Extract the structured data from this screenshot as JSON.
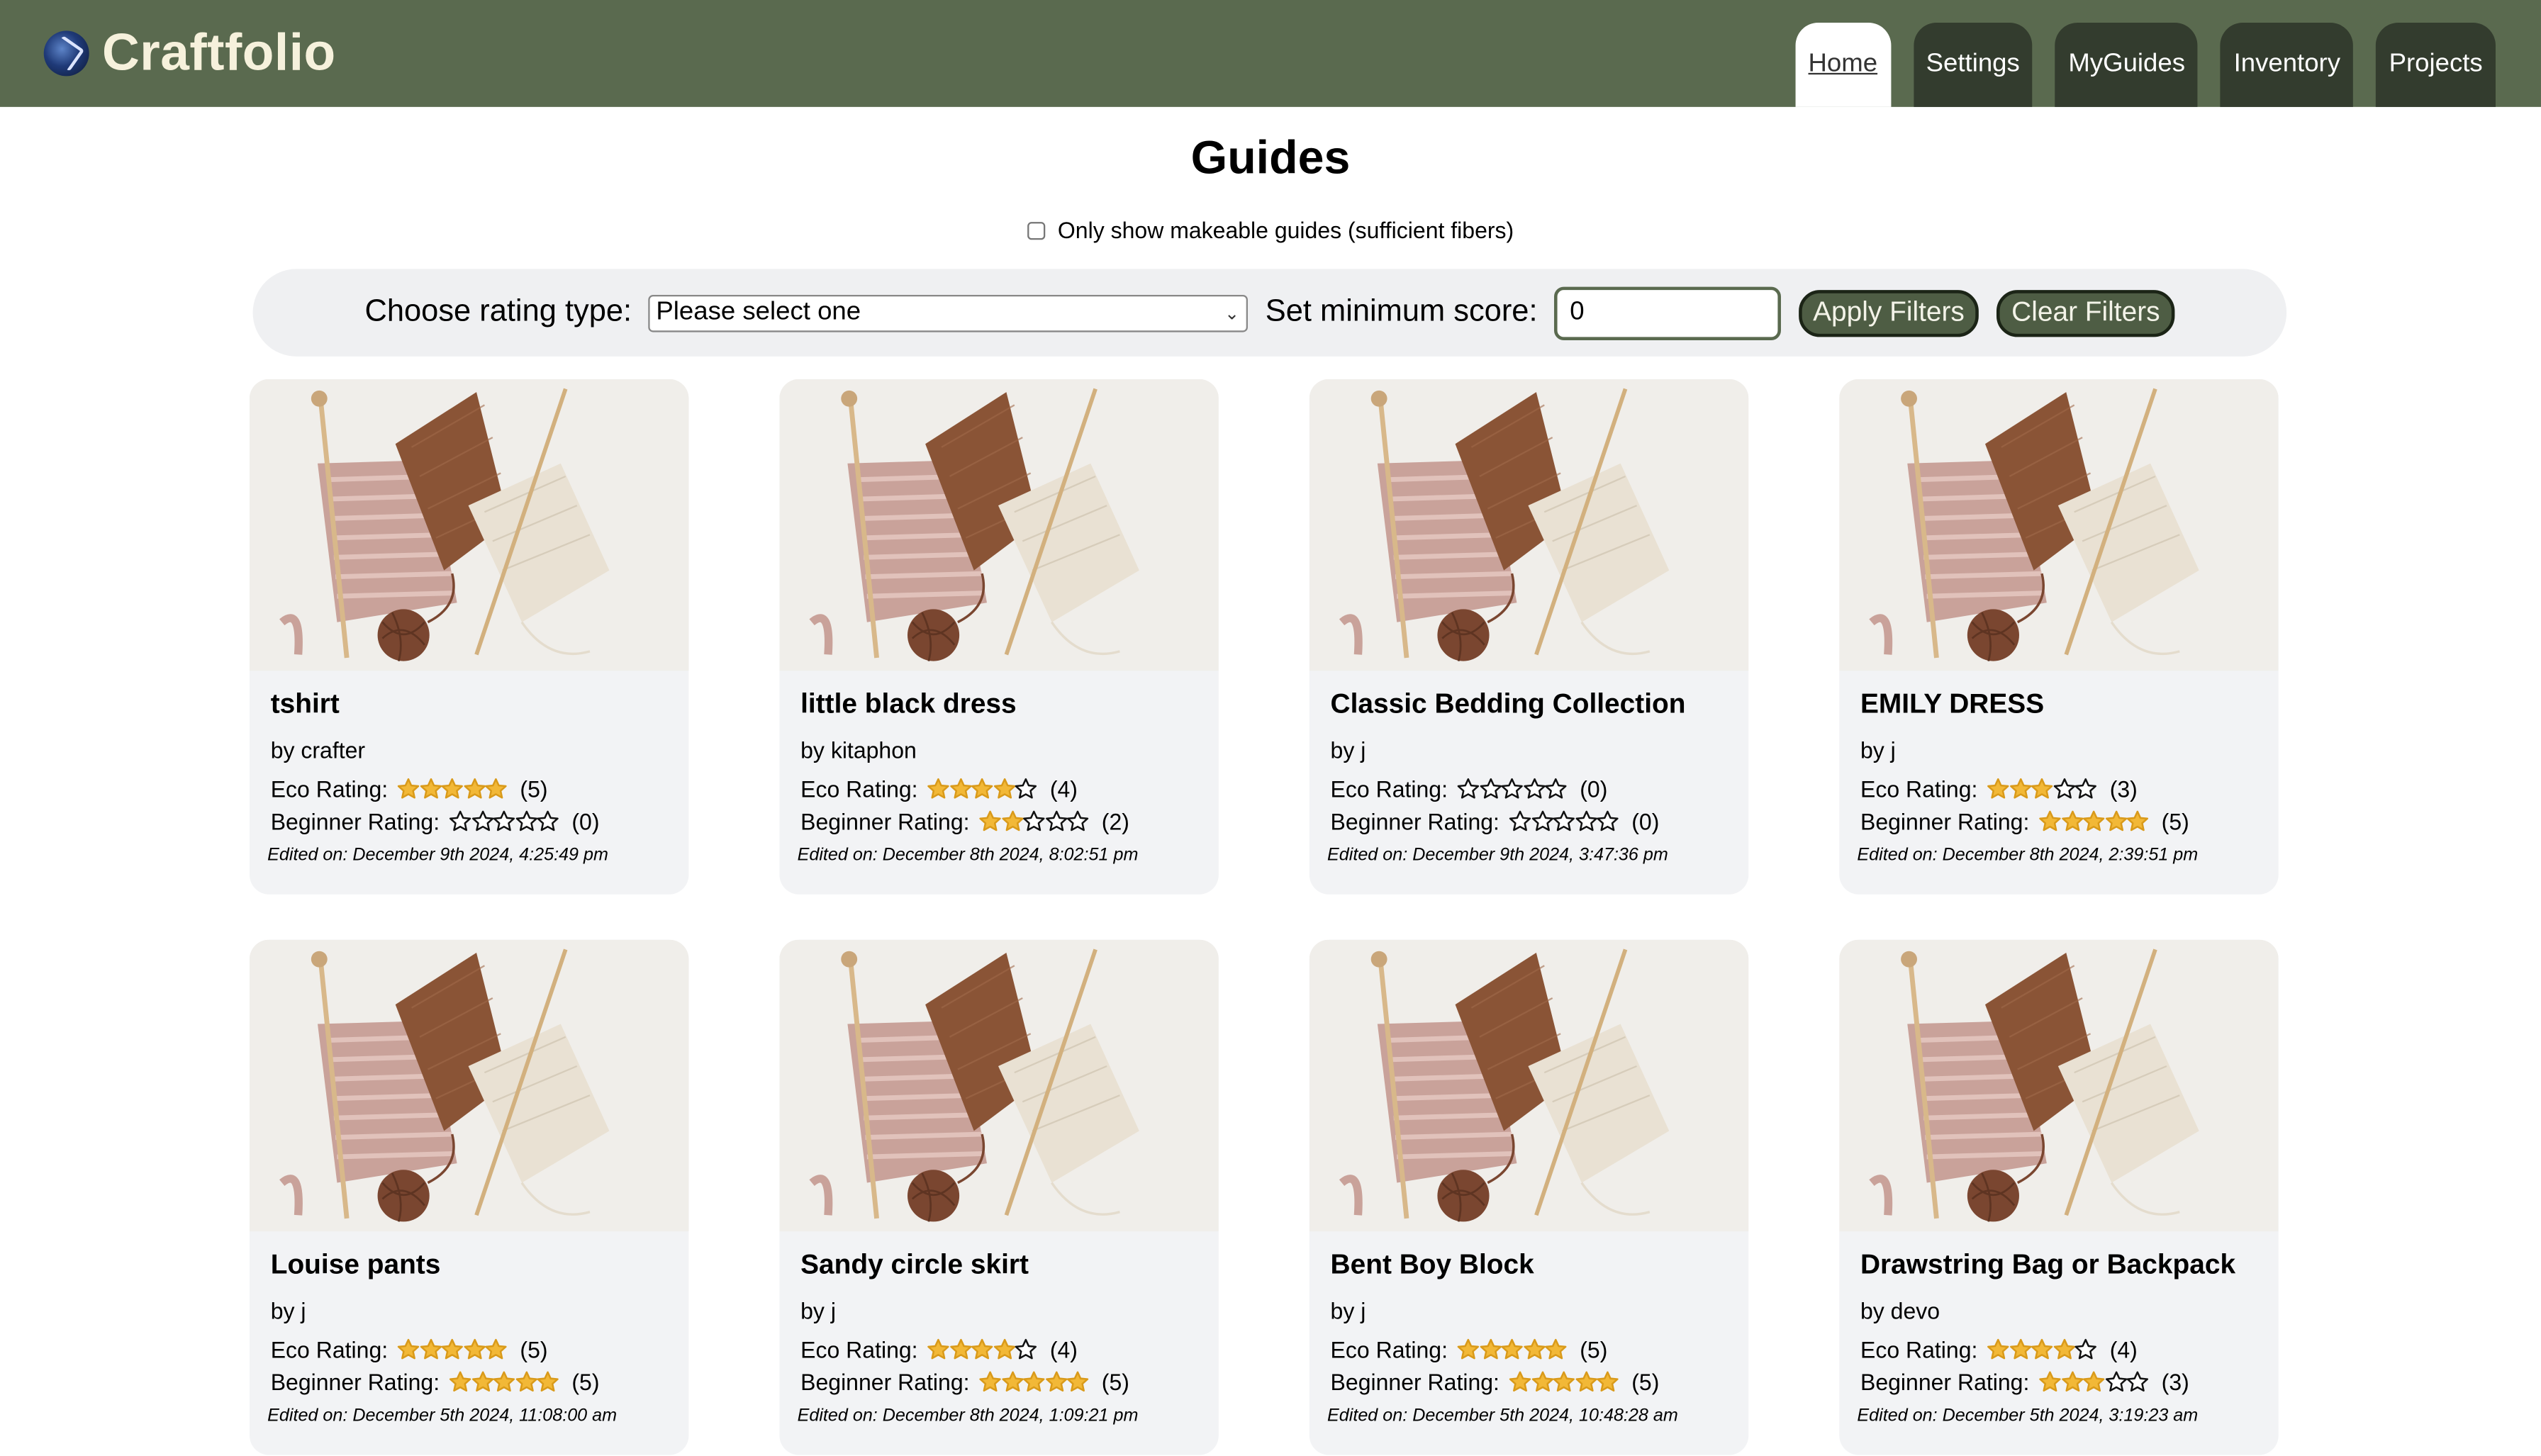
{
  "app": {
    "brand": "Craftfolio",
    "brand_color": "#5a6a4f",
    "logo_icon": "globe-logo-icon"
  },
  "nav": [
    {
      "label": "Home",
      "active": true
    },
    {
      "label": "Settings",
      "active": false
    },
    {
      "label": "MyGuides",
      "active": false
    },
    {
      "label": "Inventory",
      "active": false
    },
    {
      "label": "Projects",
      "active": false
    }
  ],
  "page": {
    "title": "Guides",
    "makeable_label": "Only show makeable guides (sufficient fibers)",
    "makeable_checked": false
  },
  "filters": {
    "rating_type_label": "Choose rating type:",
    "rating_type_value": "Please select one",
    "min_score_label": "Set minimum score:",
    "min_score_value": "0",
    "apply_label": "Apply Filters",
    "clear_label": "Clear Filters"
  },
  "labels": {
    "eco": "Eco Rating:",
    "beginner": "Beginner Rating:"
  },
  "guides": [
    {
      "title": "tshirt",
      "author": "by crafter",
      "eco": 5,
      "eco_count": "(5)",
      "beginner": 0,
      "beginner_count": "(0)",
      "edited": "Edited on: December 9th 2024, 4:25:49 pm"
    },
    {
      "title": "little black dress",
      "author": "by kitaphon",
      "eco": 4,
      "eco_count": "(4)",
      "beginner": 2,
      "beginner_count": "(2)",
      "edited": "Edited on: December 8th 2024, 8:02:51 pm"
    },
    {
      "title": "Classic Bedding Collection",
      "author": "by j",
      "eco": 0,
      "eco_count": "(0)",
      "beginner": 0,
      "beginner_count": "(0)",
      "edited": "Edited on: December 9th 2024, 3:47:36 pm"
    },
    {
      "title": "EMILY DRESS",
      "author": "by j",
      "eco": 3,
      "eco_count": "(3)",
      "beginner": 5,
      "beginner_count": "(5)",
      "edited": "Edited on: December 8th 2024, 2:39:51 pm"
    },
    {
      "title": "Louise pants",
      "author": "by j",
      "eco": 5,
      "eco_count": "(5)",
      "beginner": 5,
      "beginner_count": "(5)",
      "edited": "Edited on: December 5th 2024, 11:08:00 am"
    },
    {
      "title": "Sandy circle skirt",
      "author": "by j",
      "eco": 4,
      "eco_count": "(4)",
      "beginner": 5,
      "beginner_count": "(5)",
      "edited": "Edited on: December 8th 2024, 1:09:21 pm"
    },
    {
      "title": "Bent Boy Block",
      "author": "by j",
      "eco": 5,
      "eco_count": "(5)",
      "beginner": 5,
      "beginner_count": "(5)",
      "edited": "Edited on: December 5th 2024, 10:48:28 am"
    },
    {
      "title": "Drawstring Bag or Backpack",
      "author": "by devo",
      "eco": 4,
      "eco_count": "(4)",
      "beginner": 3,
      "beginner_count": "(3)",
      "edited": "Edited on: December 5th 2024, 3:19:23 am"
    }
  ],
  "colors": {
    "star_fill": "#f2b837",
    "card_bg": "#f2f3f5",
    "nav_tab": "#333c2e"
  }
}
